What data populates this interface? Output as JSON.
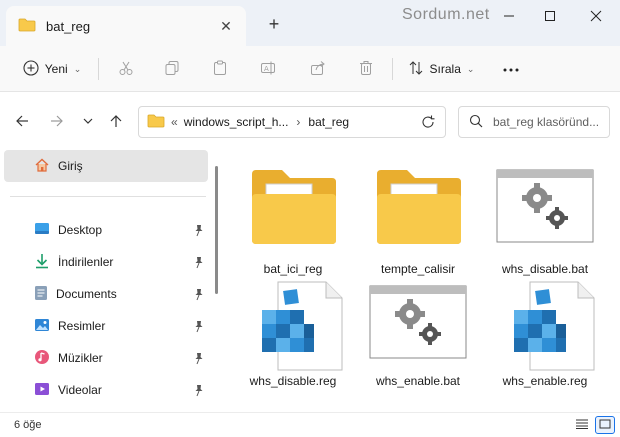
{
  "window": {
    "tab_title": "bat_reg",
    "watermark": "Sordum.net"
  },
  "toolbar": {
    "new_label": "Yeni",
    "sort_label": "Sırala"
  },
  "address": {
    "prefix": "«",
    "parent": "windows_script_h...",
    "separator": "›",
    "current": "bat_reg",
    "search_placeholder": "bat_reg klasöründ..."
  },
  "sidebar": {
    "home_label": "Giriş",
    "items": [
      {
        "label": "Desktop",
        "icon": "desktop-icon"
      },
      {
        "label": "İndirilenler",
        "icon": "downloads-icon"
      },
      {
        "label": "Documents",
        "icon": "documents-icon"
      },
      {
        "label": "Resimler",
        "icon": "pictures-icon"
      },
      {
        "label": "Müzikler",
        "icon": "music-icon"
      },
      {
        "label": "Videolar",
        "icon": "videos-icon"
      }
    ]
  },
  "files": [
    {
      "name": "bat_ici_reg",
      "type": "folder"
    },
    {
      "name": "tempte_calisir",
      "type": "folder"
    },
    {
      "name": "whs_disable.bat",
      "type": "bat"
    },
    {
      "name": "whs_disable.reg",
      "type": "reg"
    },
    {
      "name": "whs_enable.bat",
      "type": "bat"
    },
    {
      "name": "whs_enable.reg",
      "type": "reg"
    }
  ],
  "status": {
    "item_count": "6 öğe"
  },
  "colors": {
    "folder_yellow": "#f8c94a",
    "accent_blue": "#1a73e8",
    "registry_blue": "#2f8fd6"
  }
}
